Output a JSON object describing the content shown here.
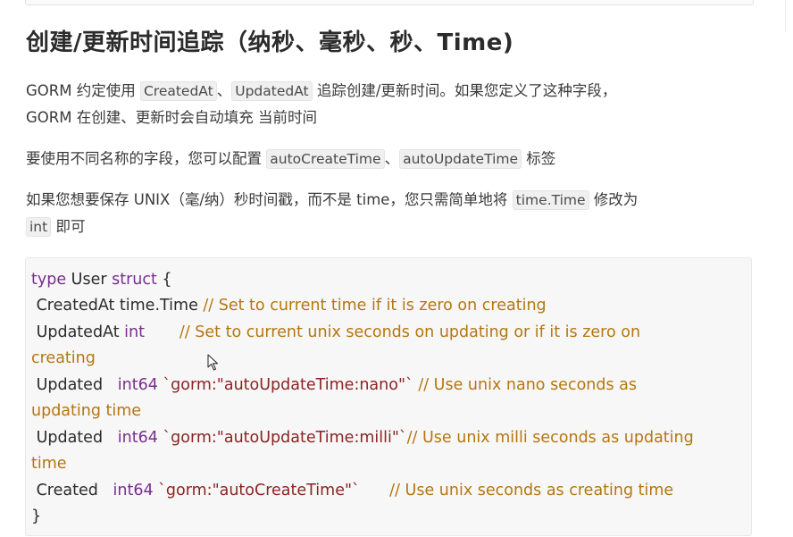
{
  "heading": "创建/更新时间追踪（纳秒、毫秒、秒、Time)",
  "para1": {
    "t1": "GORM 约定使用 ",
    "c1": "CreatedAt",
    "t2": "、",
    "c2": "UpdatedAt",
    "t3": " 追踪创建/更新时间。如果您定义了这种字段，",
    "line2": "GORM 在创建、更新时会自动填充 当前时间"
  },
  "para2": {
    "t1": "要使用不同名称的字段，您可以配置 ",
    "c1": "autoCreateTime",
    "t2": "、",
    "c2": "autoUpdateTime",
    "t3": " 标签"
  },
  "para3": {
    "t1": "如果您想要保存 UNIX（毫/纳）秒时间戳，而不是 time，您只需简单地将 ",
    "c1": "time.Time",
    "t2": " 修改为",
    "c2": "int",
    "t3": " 即可"
  },
  "code": {
    "l1_kw": "type",
    "l1_name": " User ",
    "l1_kw2": "struct",
    "l1_brace": " {",
    "l2_field": " CreatedAt time.Time ",
    "l2_cmt": "// Set to current time if it is zero on creating",
    "l3_field": " UpdatedAt ",
    "l3_type": "int",
    "l3_pad": "       ",
    "l3_cmt": "// Set to current unix seconds on updating or if it is zero on",
    "l4_cmt": "creating",
    "l5_field": " Updated   ",
    "l5_type": "int64",
    "l5_tag": " `gorm:\"autoUpdateTime:nano\"`",
    "l5_cmt": " // Use unix nano seconds as",
    "l6_cmt": "updating time",
    "l7_field": " Updated   ",
    "l7_type": "int64",
    "l7_tag": " `gorm:\"autoUpdateTime:milli\"`",
    "l7_cmt": "// Use unix milli seconds as updating",
    "l8_cmt": "time",
    "l9_field": " Created   ",
    "l9_type": "int64",
    "l9_tag": " `gorm:\"autoCreateTime\"`",
    "l9_pad": "      ",
    "l9_cmt": "// Use unix seconds as creating time",
    "l10": "}"
  }
}
